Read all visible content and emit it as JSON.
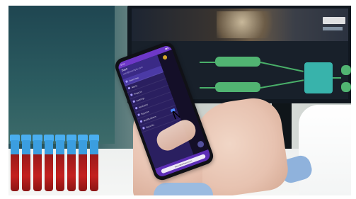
{
  "phone": {
    "status": {
      "time": "9:41"
    },
    "menu": {
      "title": "Dash",
      "subtitle": "user@example.com",
      "items": [
        {
          "label": "Overview",
          "active": true
        },
        {
          "label": "Alerts",
          "active": false
        },
        {
          "label": "Projects",
          "active": false
        },
        {
          "label": "Settings",
          "active": false
        },
        {
          "label": "Analytics",
          "active": false
        },
        {
          "label": "Reports",
          "active": false
        },
        {
          "label": "Notifications",
          "badge": "New"
        },
        {
          "label": "Security",
          "active": false
        }
      ]
    },
    "browser": {
      "address": "www.dashboard.com"
    }
  }
}
